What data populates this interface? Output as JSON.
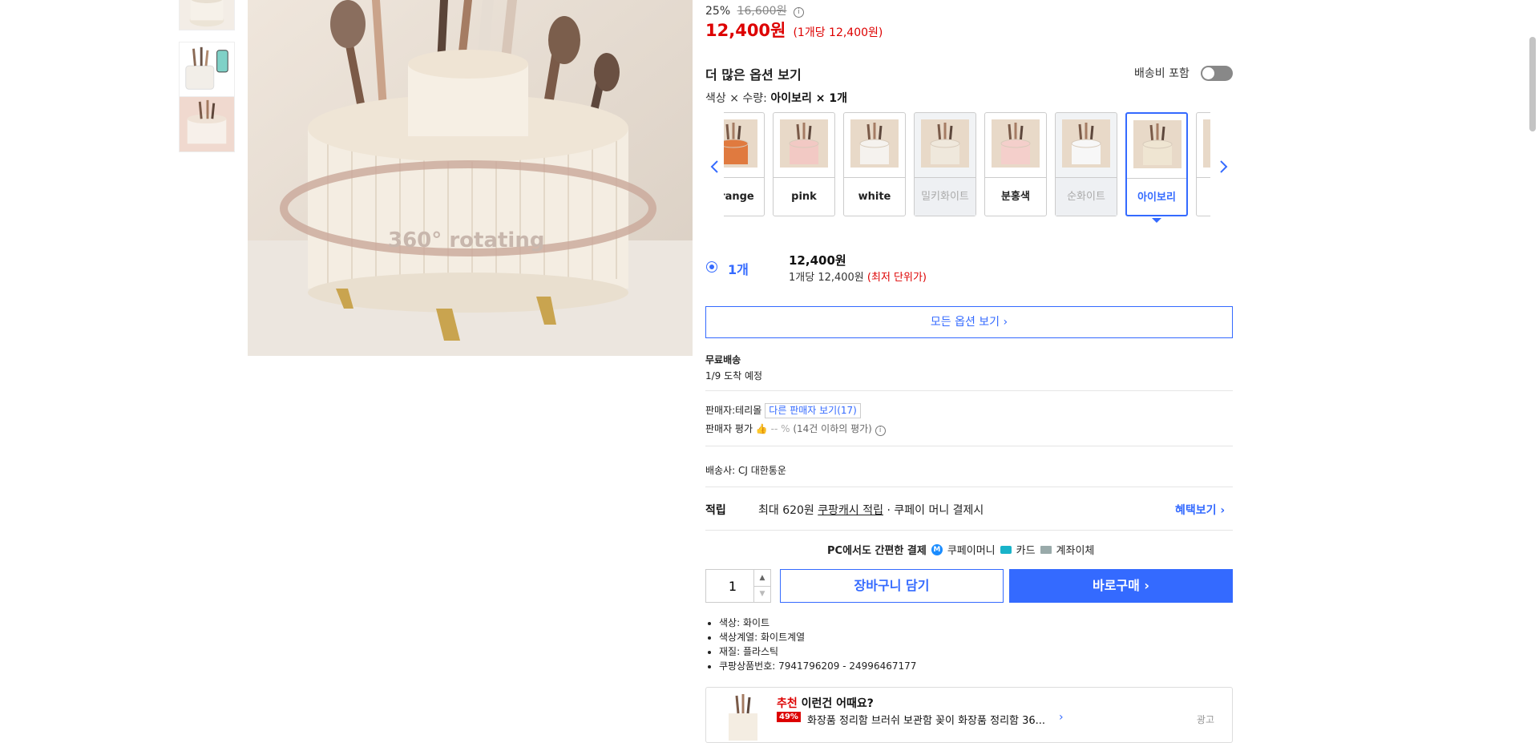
{
  "price": {
    "discount_percent": "25%",
    "original_price": "16,600원",
    "info_icon": "info-icon",
    "sale_price": "12,400원",
    "unit_price_note": "(1개당 12,400원)"
  },
  "options": {
    "title": "더 많은 옵션 보기",
    "shipping_toggle_label": "배송비 포함",
    "shipping_toggle_on": false,
    "selection_prefix": "색상 × 수량: ",
    "selection_value": "아이보리 × 1개",
    "variants": [
      {
        "label": "orange",
        "thumb_color": "#e07a3f",
        "state": "normal"
      },
      {
        "label": "pink",
        "thumb_color": "#f2c9c4",
        "state": "normal"
      },
      {
        "label": "white",
        "thumb_color": "#f5f2ee",
        "state": "normal"
      },
      {
        "label": "밀키화이트",
        "thumb_color": "#efe8dc",
        "state": "disabled"
      },
      {
        "label": "분홍색",
        "thumb_color": "#f4cfcb",
        "state": "normal"
      },
      {
        "label": "순화이트",
        "thumb_color": "#f7f7f7",
        "state": "disabled"
      },
      {
        "label": "아이보리",
        "thumb_color": "#efe5d2",
        "state": "selected"
      },
      {
        "label": "",
        "thumb_color": "#eeeeee",
        "state": "normal"
      }
    ],
    "prev_icon": "chevron-left-icon",
    "next_icon": "chevron-right-icon"
  },
  "quantity_option": {
    "label": "1개",
    "price": "12,400원",
    "unit_text": "1개당 12,400원 ",
    "lowest_tag": "(최저 단위가)"
  },
  "all_options_button": "모든 옵션 보기 ›",
  "delivery": {
    "free_label": "무료배송",
    "arrival": "1/9 도착 예정"
  },
  "seller": {
    "name_label": "판매자:테리몰",
    "other_sellers": "다른 판매자 보기(17)",
    "rating_label": "판매자 평가",
    "rating_value": "-- %",
    "rating_note": "(14건 이하의 평가)"
  },
  "carrier": "배송사:  CJ 대한통운",
  "reward": {
    "label": "적립",
    "text_prefix": "최대 620원 ",
    "text_link": "쿠팡캐시 적립",
    "text_suffix": " · 쿠페이 머니 결제시",
    "benefit_link": "혜택보기 ›"
  },
  "payment": {
    "prefix": "PC에서도 간편한 결제",
    "coupay_money": "쿠페이머니",
    "card": "카드",
    "bank": "계좌이체"
  },
  "purchase": {
    "quantity": "1",
    "cart_button": "장바구니 담기",
    "buy_button": "바로구매 ›"
  },
  "specs": [
    "색상: 화이트",
    "색상계열: 화이트계열",
    "재질: 플라스틱",
    "쿠팡상품번호: 7941796209 - 24996467177"
  ],
  "recommendation": {
    "title_red": "추천",
    "title_rest": " 이런건 어때요?",
    "discount_badge": "49%",
    "product_name": "화장품 정리함 브러쉬 보관함 꽂이 화장품 정리함 36...",
    "ad_label": "광고"
  },
  "main_image": {
    "caption": "360° rotating"
  }
}
